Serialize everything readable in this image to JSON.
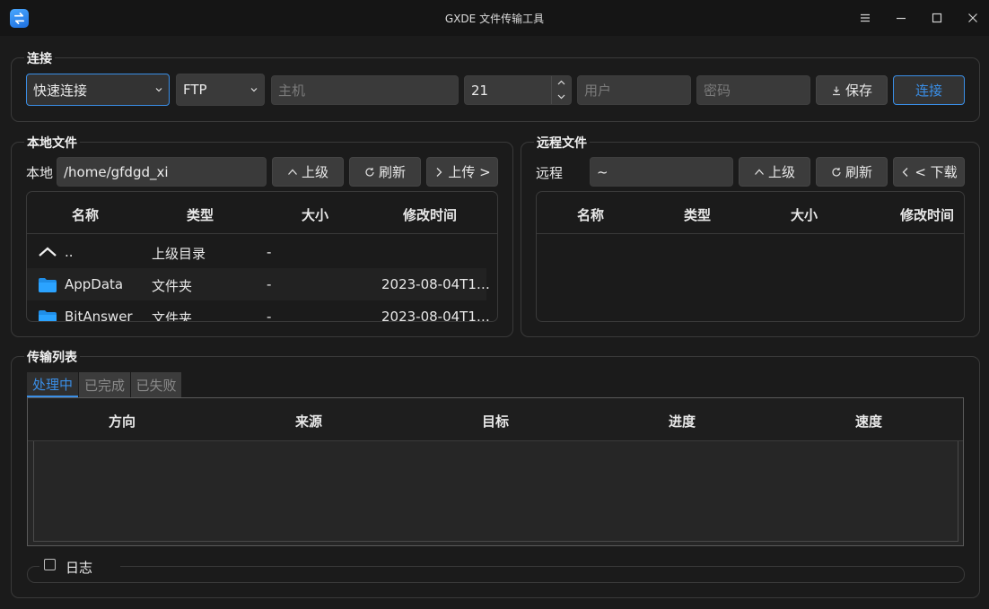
{
  "window": {
    "title": "GXDE 文件传输工具",
    "icons": [
      "app-icon",
      "menu-icon",
      "minimize-icon",
      "maximize-icon",
      "close-icon"
    ]
  },
  "connection": {
    "group_title": "连接",
    "quick_connect": "快速连接",
    "protocol": "FTP",
    "host_placeholder": "主机",
    "port": "21",
    "user_placeholder": "用户",
    "password_placeholder": "密码",
    "save_label": "保存",
    "connect_label": "连接"
  },
  "local": {
    "group_title": "本地文件",
    "path_label": "本地",
    "path": "/home/gfdgd_xi",
    "up_label": "上级",
    "refresh_label": "刷新",
    "upload_label": "上传 >",
    "columns": [
      "名称",
      "类型",
      "大小",
      "修改时间"
    ],
    "rows": [
      {
        "name": "..",
        "type": "上级目录",
        "size": "-",
        "modified": "",
        "icon": "parent-dir-icon"
      },
      {
        "name": "AppData",
        "type": "文件夹",
        "size": "-",
        "modified": "2023-08-04T1…",
        "icon": "folder-icon"
      },
      {
        "name": "BitAnswer",
        "type": "文件夹",
        "size": "-",
        "modified": "2023-08-04T1…",
        "icon": "folder-icon"
      }
    ]
  },
  "remote": {
    "group_title": "远程文件",
    "path_label": "远程",
    "path": "~",
    "up_label": "上级",
    "refresh_label": "刷新",
    "download_label": "< 下载",
    "columns": [
      "名称",
      "类型",
      "大小",
      "修改时间"
    ]
  },
  "transfers": {
    "group_title": "传输列表",
    "tabs": [
      "处理中",
      "已完成",
      "已失败"
    ],
    "active_tab": "处理中",
    "columns": [
      "方向",
      "来源",
      "目标",
      "进度",
      "速度"
    ],
    "log_label": "日志",
    "log_checked": false
  },
  "colors": {
    "accent": "#3a8ee6",
    "background": "#1b1b1b",
    "field": "#3a3a3a"
  }
}
